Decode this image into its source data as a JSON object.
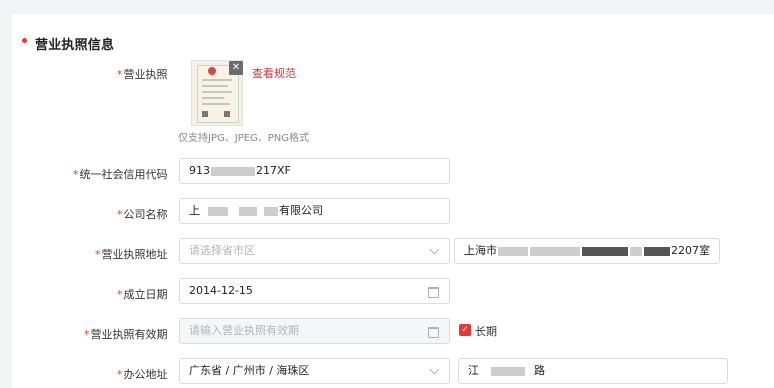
{
  "section": {
    "title": "营业执照信息"
  },
  "fields": {
    "license": {
      "req": "*",
      "label": "营业执照",
      "view_spec": "查看规范",
      "hint": "仅支持JPG、JPEG、PNG格式",
      "close_symbol": "✕"
    },
    "credit_code": {
      "req": "*",
      "label": "统一社会信用代码",
      "value_prefix": "913",
      "value_suffix": "217XF"
    },
    "company_name": {
      "req": "*",
      "label": "公司名称",
      "value_prefix": "上",
      "value_suffix": "有限公司"
    },
    "license_address": {
      "req": "*",
      "label": "营业执照地址",
      "region_placeholder": "请选择省市区",
      "detail_prefix": "上海市",
      "detail_suffix": "2207室"
    },
    "established_date": {
      "req": "*",
      "label": "成立日期",
      "value": "2014-12-15"
    },
    "validity": {
      "req": "*",
      "label": "营业执照有效期",
      "placeholder": "请输入营业执照有效期",
      "long_term_checked": true,
      "long_term_label": "长期",
      "check_symbol": "✓"
    },
    "office_address": {
      "req": "*",
      "label": "办公地址",
      "region_value": "广东省 / 广州市 / 海珠区",
      "detail_prefix": "江",
      "detail_suffix": "路"
    }
  },
  "colors": {
    "accent": "#e53935",
    "link": "#d9363e"
  },
  "icons": {
    "close": "close-icon",
    "calendar": "calendar-icon",
    "chevron": "chevron-down-icon"
  }
}
